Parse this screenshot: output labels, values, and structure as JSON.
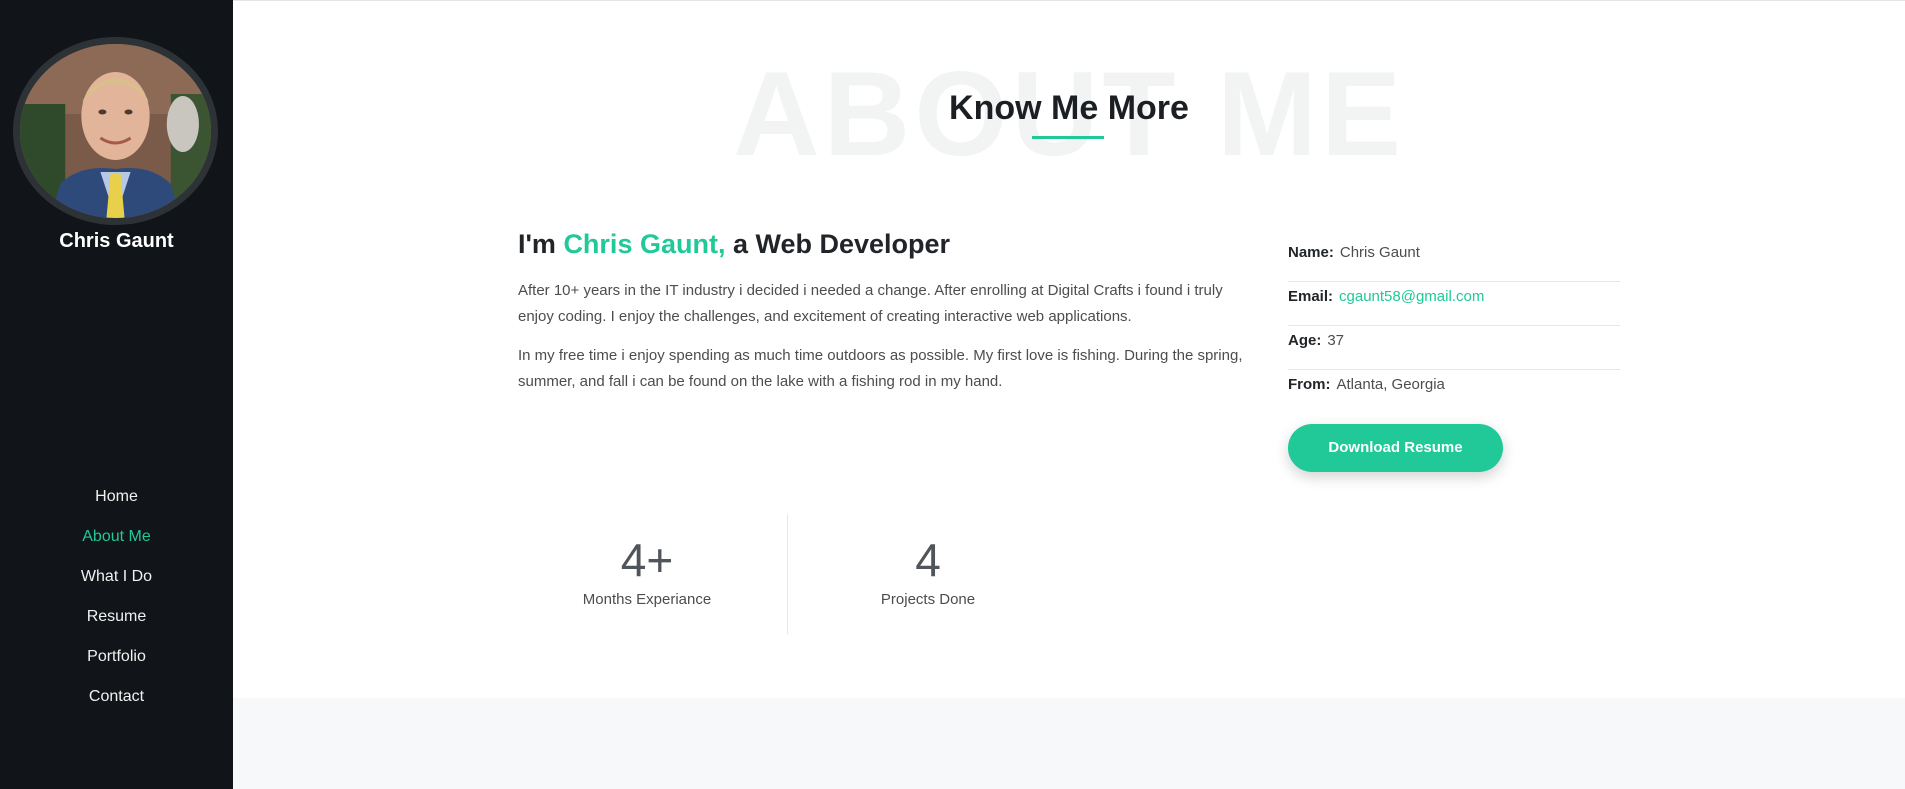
{
  "sidebar": {
    "name": "Chris Gaunt",
    "nav": [
      {
        "label": "Home",
        "active": false
      },
      {
        "label": "About Me",
        "active": true
      },
      {
        "label": "What I Do",
        "active": false
      },
      {
        "label": "Resume",
        "active": false
      },
      {
        "label": "Portfolio",
        "active": false
      },
      {
        "label": "Contact",
        "active": false
      }
    ]
  },
  "about": {
    "watermark": "ABOUT ME",
    "title": "Know Me More",
    "heading_prefix": "I'm ",
    "heading_name": "Chris Gaunt,",
    "heading_suffix": " a Web Developer",
    "paragraphs": [
      "After 10+ years in the IT industry i decided i needed a change. After enrolling at Digital Crafts i found i truly enjoy coding. I enjoy the challenges, and excitement of creating interactive web applications.",
      "In my free time i enjoy spending as much time outdoors as possible. My first love is fishing. During the spring, summer, and fall i can be found on the lake with a fishing rod in my hand."
    ],
    "info": {
      "name_label": "Name:",
      "name_value": "Chris Gaunt",
      "email_label": "Email:",
      "email_value": "cgaunt58@gmail.com",
      "age_label": "Age:",
      "age_value": "37",
      "from_label": "From:",
      "from_value": "Atlanta, Georgia"
    },
    "download_label": "Download Resume",
    "stats": [
      {
        "value": "4+",
        "label": "Months Experiance"
      },
      {
        "value": "4",
        "label": "Projects Done"
      }
    ]
  },
  "colors": {
    "accent": "#20c997",
    "sidebar_bg": "#111418"
  }
}
